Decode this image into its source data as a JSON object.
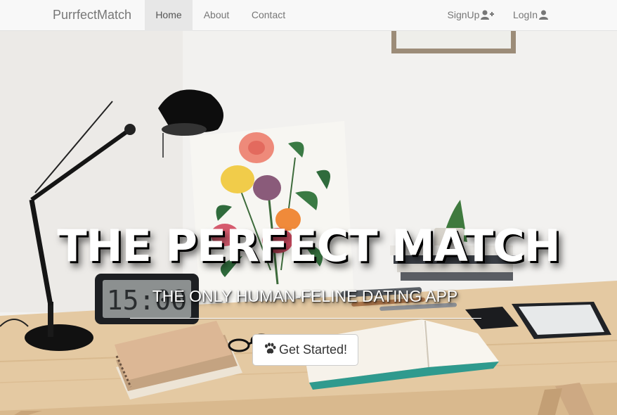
{
  "navbar": {
    "brand": "PurrfectMatch",
    "links": [
      {
        "label": "Home",
        "active": true
      },
      {
        "label": "About",
        "active": false
      },
      {
        "label": "Contact",
        "active": false
      }
    ],
    "signup_label": "SignUp",
    "signup_icon": "user-plus-icon",
    "login_label": "LogIn",
    "login_icon": "user-icon"
  },
  "hero": {
    "headline": "THE PERFECT MATCH",
    "subheadline": "THE ONLY HUMAN-FELINE DATING APP",
    "cta_label": "Get Started!",
    "cta_icon": "paw-icon",
    "clock_text": "15:00"
  },
  "colors": {
    "navbar_bg": "#f8f8f8",
    "active_tab_bg": "#e7e7e7",
    "nav_text": "#777777",
    "hero_text": "#ffffff",
    "desk_wood": "#e6cda8"
  }
}
